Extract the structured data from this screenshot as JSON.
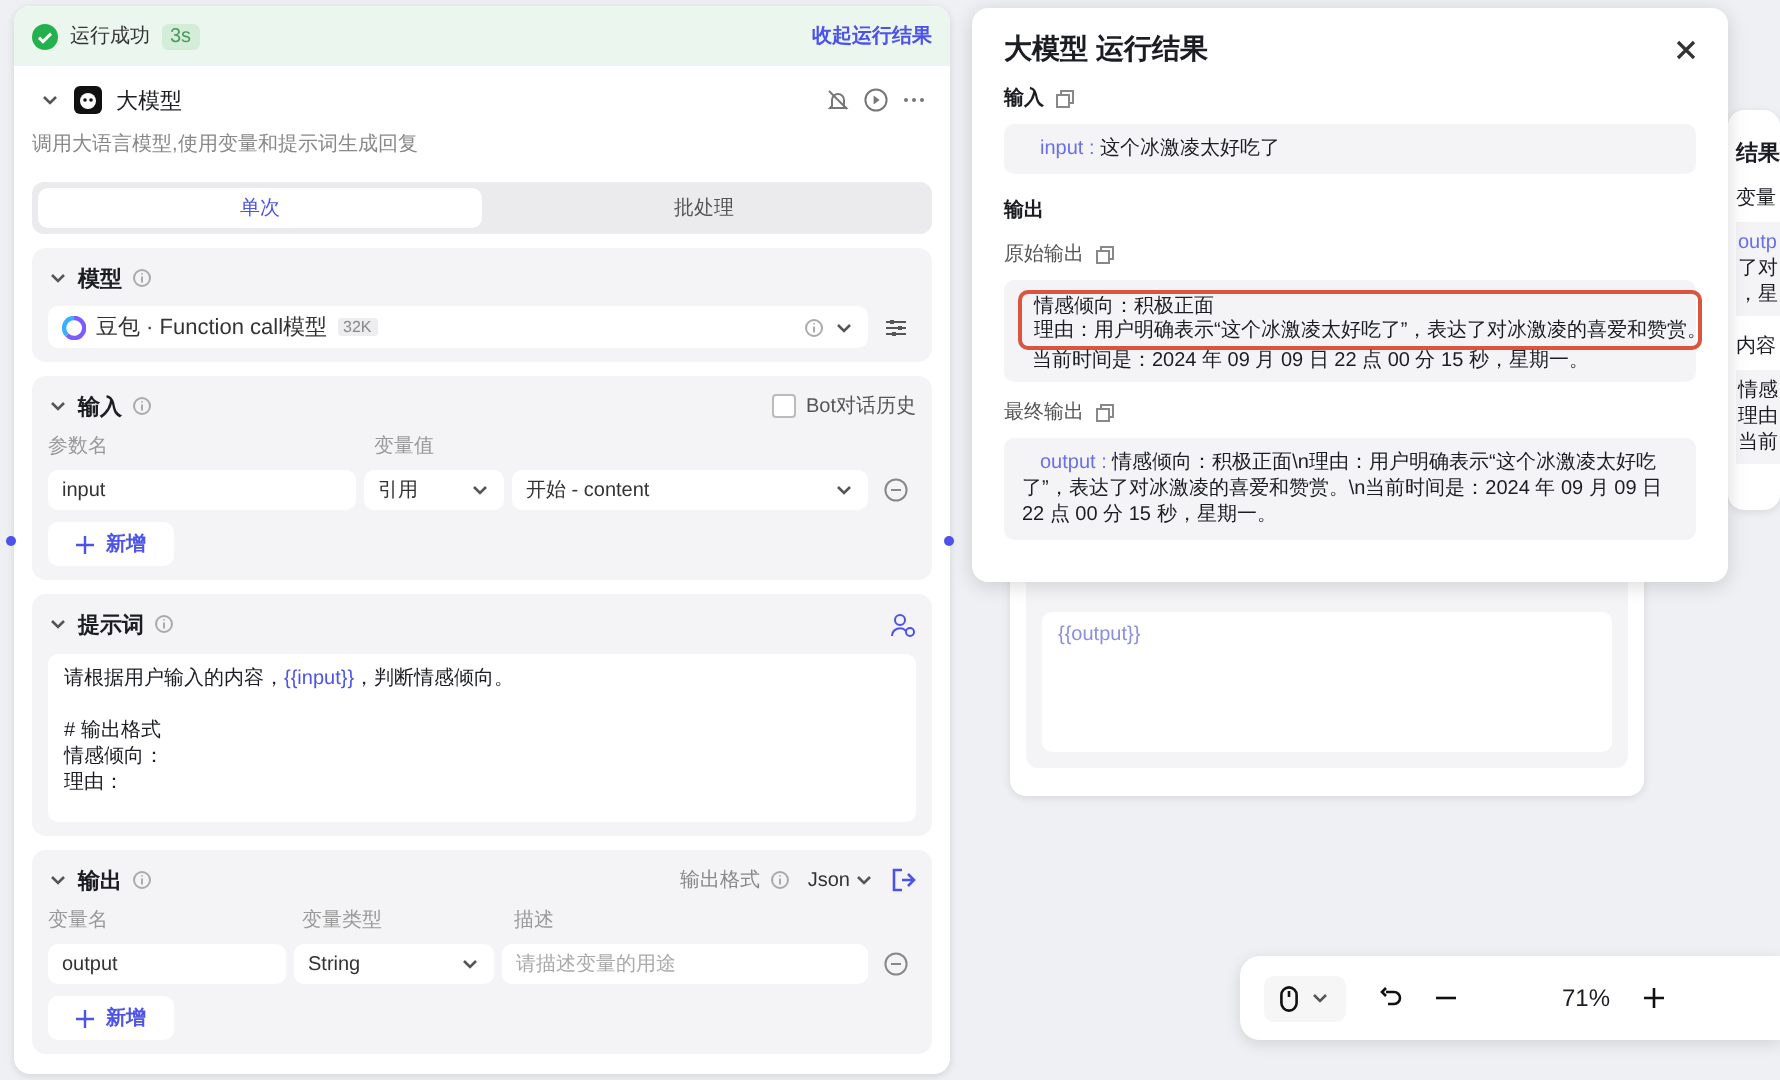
{
  "status_bar": {
    "text": "运行成功",
    "duration": "3s",
    "collapse_link": "收起运行结果"
  },
  "node": {
    "title": "大模型",
    "description": "调用大语言模型,使用变量和提示词生成回复"
  },
  "tabs": [
    {
      "label": "单次",
      "selected": true
    },
    {
      "label": "批处理",
      "selected": false
    }
  ],
  "model_section": {
    "title": "模型",
    "model": "豆包 · Function call模型",
    "badge": "32K"
  },
  "input_section": {
    "title": "输入",
    "bot_history": {
      "label": "Bot对话历史",
      "checked": false
    },
    "columns": [
      "参数名",
      "变量值"
    ],
    "rows": [
      {
        "name": "input",
        "source": "引用",
        "value": "开始 - content"
      }
    ],
    "add_button": "新增"
  },
  "prompt_section": {
    "title": "提示词",
    "blocks": [
      [
        [
          {
            "kind": "text",
            "text": "请根据用户输入的内容，"
          },
          {
            "kind": "variable",
            "text": "{{input}}"
          },
          {
            "kind": "text",
            "text": "，判断情感倾向。"
          }
        ]
      ],
      [
        [
          {
            "kind": "text",
            "text": "# 输出格式"
          }
        ],
        [
          {
            "kind": "text",
            "text": "情感倾向："
          }
        ],
        [
          {
            "kind": "text",
            "text": "理由："
          }
        ]
      ]
    ]
  },
  "output_section": {
    "title": "输出",
    "format_label": "输出格式",
    "format": "Json",
    "columns": [
      "变量名",
      "变量类型",
      "描述"
    ],
    "rows": [
      {
        "name": "output",
        "type": "String",
        "placeholder": "请描述变量的用途"
      }
    ],
    "add_button": "新增"
  },
  "result_panel": {
    "title": "大模型 运行结果",
    "input_label": "输入",
    "input": {
      "key": "input :",
      "value": "这个冰激凌太好吃了"
    },
    "output_label": "输出",
    "raw_label": "原始输出",
    "raw_lines": [
      {
        "text": "情感倾向：积极正面",
        "highlighted": true
      },
      {
        "text": "理由：用户明确表示“这个冰激凌太好吃了”，表达了对冰激凌的喜爱和赞赏。",
        "highlighted": true
      },
      {
        "text": "当前时间是：2024 年 09 月 09 日 22 点 00 分 15 秒，星期一。",
        "highlighted": false
      }
    ],
    "final_label": "最终输出",
    "final": {
      "key": "output :",
      "value": "情感倾向：积极正面\\n理由：用户明确表示“这个冰激凌太好吃了”，表达了对冰激凌的喜爱和赞赏。\\n当前时间是：2024 年 09 月 09 日 22 点 00 分 15 秒，星期一。"
    }
  },
  "end_node": {
    "template": "{{output}}"
  },
  "side_panel": {
    "title": "结果",
    "variable_label": "变量",
    "variable_lines": [
      "outp",
      "了对",
      "，星"
    ],
    "content_label": "内容",
    "content_lines": [
      "情感",
      "理由",
      "当前"
    ]
  },
  "zoom_toolbar": {
    "zoom": "71%"
  }
}
